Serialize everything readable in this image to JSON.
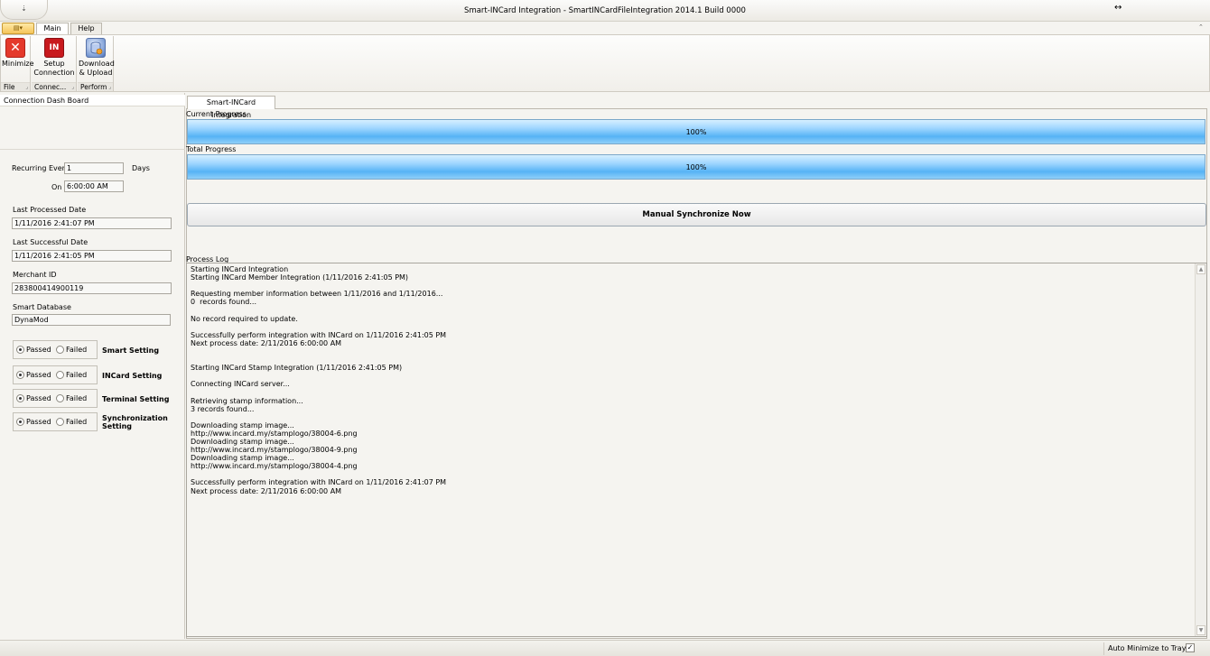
{
  "window": {
    "title": "Smart-INCard Integration - SmartINCardFileIntegration 2014.1 Build 0000",
    "quick_access_glyph": "⇣",
    "resize_glyph": "↔"
  },
  "tabs": {
    "app_button_glyph": "▤▾",
    "items": [
      "Main",
      "Help"
    ],
    "collapse_glyph": "⌃"
  },
  "ribbon": {
    "groups": [
      {
        "label": "File",
        "button": "Minimize",
        "icon": "close-x-icon"
      },
      {
        "label": "Connec...",
        "button": "Setup Connection",
        "icon": "incard-logo-icon"
      },
      {
        "label": "Perform",
        "button": "Download & Upload",
        "icon": "database-sync-icon"
      }
    ],
    "minimize_line1": "Minimize",
    "setup_line1": "Setup",
    "setup_line2": "Connection",
    "download_line1": "Download",
    "download_line2": "& Upload",
    "incard_logo_text": "IN",
    "expand_glyph": "⌟"
  },
  "dashboard": {
    "header": "Connection Dash Board",
    "recurring_label": "Recurring Every",
    "recurring_value": "1",
    "recurring_unit": "Days",
    "on_label": "On",
    "on_value": "6:00:00 AM",
    "last_processed_label": "Last Processed Date",
    "last_processed_value": "1/11/2016 2:41:07 PM",
    "last_successful_label": "Last Successful Date",
    "last_successful_value": "1/11/2016 2:41:05 PM",
    "merchant_label": "Merchant ID",
    "merchant_value": "283800414900119",
    "database_label": "Smart Database",
    "database_value": "DynaMod",
    "passed_label": "Passed",
    "failed_label": "Failed",
    "settings": [
      {
        "name": "Smart Setting",
        "state": "Passed"
      },
      {
        "name": "INCard Setting",
        "state": "Passed"
      },
      {
        "name": "Terminal Setting",
        "state": "Passed"
      },
      {
        "name": "Synchronization Setting",
        "state": "Passed"
      }
    ],
    "setting_1": "Smart Setting",
    "setting_2": "INCard Setting",
    "setting_3": "Terminal Setting",
    "setting_4_line1": "Synchronization",
    "setting_4_line2": "Setting"
  },
  "main": {
    "doc_tab": "Smart-INCard Integration",
    "current_progress_label": "Current Progress",
    "current_progress_text": "100%",
    "current_progress_value": 1.0,
    "total_progress_label": "Total Progress",
    "total_progress_text": "100%",
    "total_progress_value": 1.0,
    "sync_button": "Manual Synchronize Now",
    "process_log_label": "Process Log",
    "log_text": "Starting INCard Integration\nStarting INCard Member Integration (1/11/2016 2:41:05 PM)\n\nRequesting member information between 1/11/2016 and 1/11/2016...\n0  records found...\n\nNo record required to update.\n\nSuccessfully perform integration with INCard on 1/11/2016 2:41:05 PM\nNext process date: 2/11/2016 6:00:00 AM\n\n\nStarting INCard Stamp Integration (1/11/2016 2:41:05 PM)\n\nConnecting INCard server...\n\nRetrieving stamp information...\n3 records found...\n\nDownloading stamp image...\nhttp://www.incard.my/stamplogo/38004-6.png\nDownloading stamp image...\nhttp://www.incard.my/stamplogo/38004-9.png\nDownloading stamp image...\nhttp://www.incard.my/stamplogo/38004-4.png\n\nSuccessfully perform integration with INCard on 1/11/2016 2:41:07 PM\nNext process date: 2/11/2016 6:00:00 AM",
    "scroll_up": "▲",
    "scroll_down": "▼"
  },
  "status": {
    "auto_minimize_label": "Auto Minimize to Tray",
    "auto_minimize_checked": true,
    "check_glyph": "✓"
  }
}
